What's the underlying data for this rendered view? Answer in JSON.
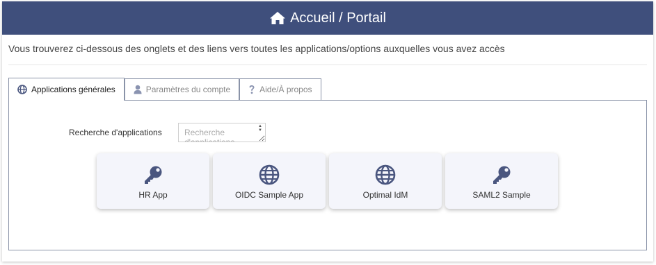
{
  "header": {
    "title": "Accueil / Portail",
    "icon": "home-icon"
  },
  "intro": "Vous trouverez ci-dessous des onglets et des liens vers toutes les applications/options auxquelles vous avez accès",
  "tabs": [
    {
      "label": "Applications générales",
      "icon": "globe-icon",
      "active": true
    },
    {
      "label": "Paramètres du compte",
      "icon": "user-icon",
      "active": false
    },
    {
      "label": "Aide/À propos",
      "icon": "question-icon",
      "active": false
    }
  ],
  "search": {
    "label": "Recherche d'applications",
    "placeholder": "Recherche d'applications"
  },
  "apps": [
    {
      "label": "HR App",
      "icon": "key-icon"
    },
    {
      "label": "OIDC Sample App",
      "icon": "globe-icon"
    },
    {
      "label": "Optimal IdM",
      "icon": "globe-icon"
    },
    {
      "label": "SAML2 Sample",
      "icon": "key-icon"
    }
  ],
  "colors": {
    "header_bg": "#3f4f7c",
    "icon": "#4a567f"
  }
}
